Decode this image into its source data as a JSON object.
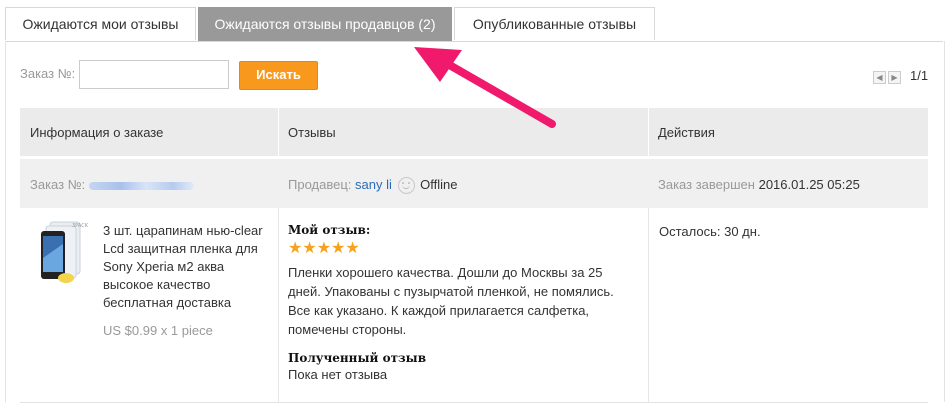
{
  "tabs": [
    {
      "label": "Ожидаются мои отзывы"
    },
    {
      "label": "Ожидаются отзывы продавцов (2)"
    },
    {
      "label": "Опубликованные отзывы"
    }
  ],
  "search": {
    "label": "Заказ №:",
    "placeholder": "",
    "button_label": "Искать"
  },
  "pager": {
    "text": "1/1"
  },
  "table": {
    "headers": [
      "Информация о заказе",
      "Отзывы",
      "Действия"
    ],
    "summary": {
      "order_label": "Заказ №:",
      "seller_label": "Продавец:",
      "seller_name": "sany li",
      "seller_status": "Offline",
      "status_label": "Заказ завершен",
      "status_date": "2016.01.25 05:25"
    },
    "row": {
      "product_title": "3 шт. царапинам нью-clear Lcd защитная пленка для Sony Xperia м2 аква высокое качество бесплатная доставка",
      "price": "US $0.99 x 1 piece",
      "my_review_heading": "Мой отзыв:",
      "stars": "★★★★★",
      "rating": 5,
      "review_text": "Пленки хорошего качества. Дошли до Москвы за 25 дней. Упакованы с пузырчатой пленкой, не помялись. Все как указано. К каждой прилагается салфетка, помечены стороны.",
      "received_heading": "Полученный отзыв",
      "received_text": "Пока нет отзыва",
      "remaining": "Осталось: 30 дн."
    }
  },
  "colors": {
    "active_tab": "#999999",
    "search_button": "#f8981d",
    "star": "#f8a21c",
    "link": "#2b6cb8",
    "annotation_arrow": "#f0196b"
  }
}
